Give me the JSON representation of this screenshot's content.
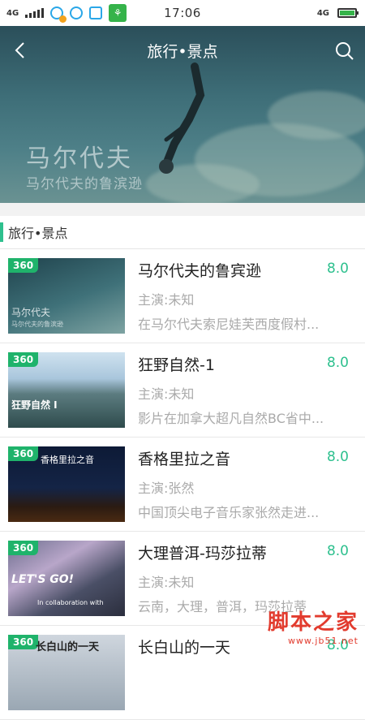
{
  "status_bar": {
    "network_left": "4G",
    "time": "17:06",
    "network_right": "4G"
  },
  "hero": {
    "title": "旅行•景点",
    "caption": "马尔代夫",
    "subcaption": "马尔代夫的鲁滨逊"
  },
  "section": {
    "title": "旅行•景点"
  },
  "items": [
    {
      "badge": "360",
      "thumb_text": "马尔代夫",
      "thumb_sub": "马尔代夫的鲁滨逊",
      "title": "马尔代夫的鲁宾逊",
      "score": "8.0",
      "cast": "主演:未知",
      "desc": "在马尔代夫索尼娃芙西度假村..."
    },
    {
      "badge": "360",
      "thumb_text": "狂野自然 I",
      "thumb_sub": "",
      "title": "狂野自然-1",
      "score": "8.0",
      "cast": "主演:未知",
      "desc": "影片在加拿大超凡自然BC省中..."
    },
    {
      "badge": "360",
      "thumb_text": "香格里拉之音",
      "thumb_sub": "",
      "title": "香格里拉之音",
      "score": "8.0",
      "cast": "主演:张然",
      "desc": "中国顶尖电子音乐家张然走进..."
    },
    {
      "badge": "360",
      "thumb_text": "LET'S GO!",
      "thumb_sub": "In collaboration with",
      "title": "大理普洱-玛莎拉蒂",
      "score": "8.0",
      "cast": "主演:未知",
      "desc": "云南，大理，普洱，玛莎拉蒂"
    },
    {
      "badge": "360",
      "thumb_text": "长白山的一天",
      "thumb_sub": "",
      "title": "长白山的一天",
      "score": "8.0",
      "cast": "",
      "desc": ""
    }
  ],
  "watermark": {
    "main": "脚本之家",
    "sub": "www.jb51.net"
  }
}
